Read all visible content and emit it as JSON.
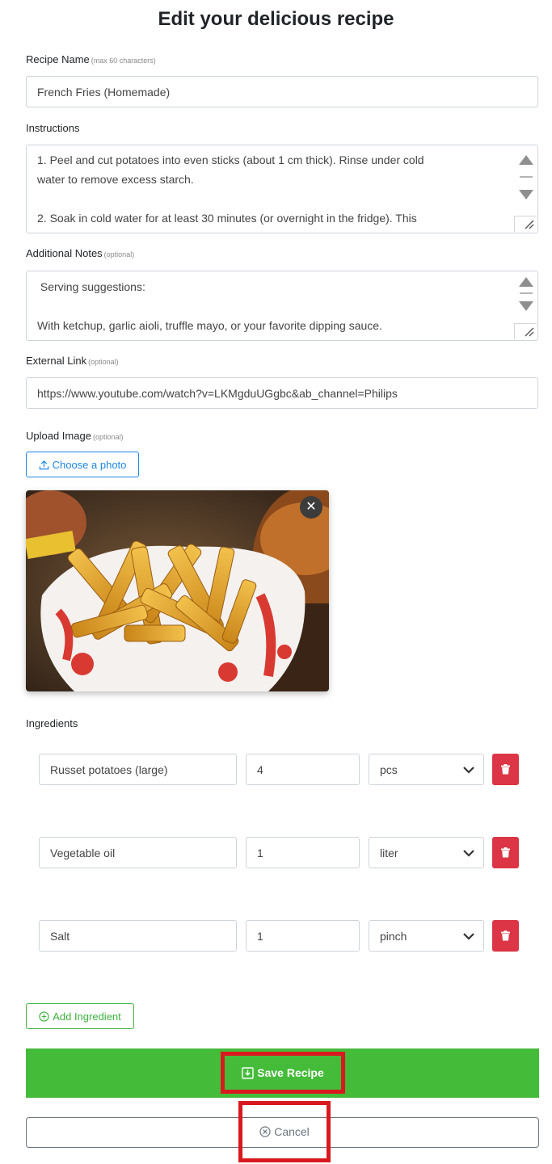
{
  "page": {
    "title": "Edit your delicious recipe"
  },
  "recipe_name": {
    "label": "Recipe Name",
    "hint": "(max 60 characters)",
    "value": "French Fries (Homemade)"
  },
  "instructions": {
    "label": "Instructions",
    "lines": [
      "1. Peel and cut potatoes into even sticks (about 1 cm thick). Rinse under cold",
      "water to remove excess starch.",
      "",
      "2. Soak in cold water for at least 30 minutes (or overnight in the fridge). This"
    ]
  },
  "notes": {
    "label": "Additional Notes",
    "hint": "(optional)",
    "lines": [
      " Serving suggestions:",
      "",
      "With ketchup, garlic aioli, truffle mayo, or your favorite dipping sauce."
    ]
  },
  "external_link": {
    "label": "External Link",
    "hint": "(optional)",
    "value": "https://www.youtube.com/watch?v=LKMgduUGgbc&ab_channel=Philips"
  },
  "upload": {
    "label": "Upload Image",
    "hint": "(optional)",
    "button_label": "Choose a photo",
    "image_name": "french-fries-photo",
    "close_glyph": "✕"
  },
  "ingredients": {
    "label": "Ingredients",
    "rows": [
      {
        "name": "Russet potatoes (large)",
        "quantity": "4",
        "unit": "pcs"
      },
      {
        "name": "Vegetable oil",
        "quantity": "1",
        "unit": "liter"
      },
      {
        "name": "Salt",
        "quantity": "1",
        "unit": "pinch"
      }
    ],
    "add_button_label": "Add Ingredient"
  },
  "actions": {
    "save_label": "Save Recipe",
    "cancel_label": "Cancel"
  },
  "colors": {
    "accent_blue": "#1e88e5",
    "save_green": "#45bb3a",
    "delete_red": "#dc3545",
    "highlight_red": "#d9191f"
  }
}
